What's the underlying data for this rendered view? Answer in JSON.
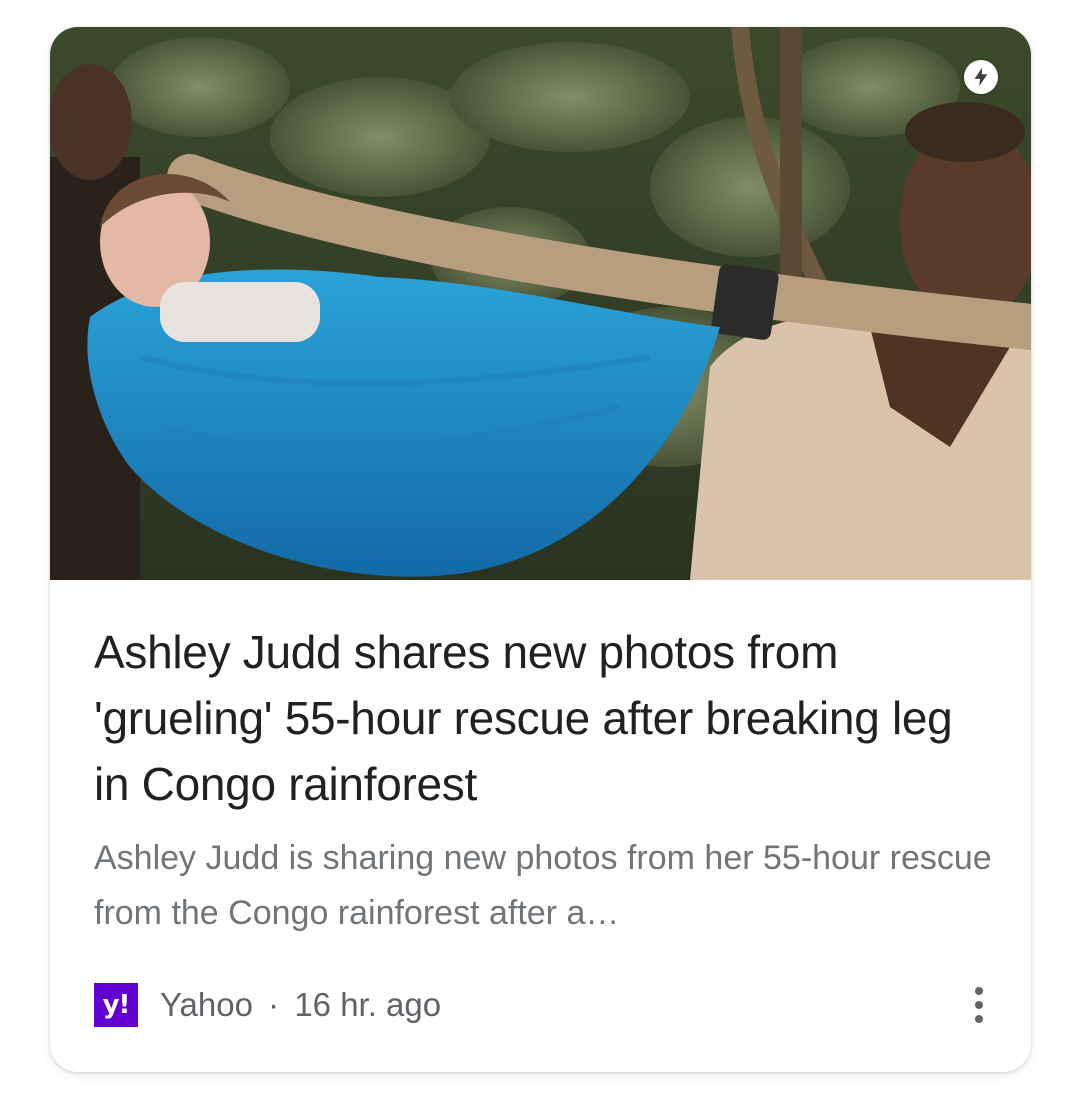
{
  "card": {
    "title": "Ashley Judd shares new photos from 'grueling' 55-hour rescue after breaking leg in Congo rainforest",
    "snippet": "Ashley Judd is sharing new photos from her 55-hour rescue from the Congo rainforest after a…",
    "amp_icon": "lightning-bolt-icon",
    "source": {
      "logo_text": "y!",
      "logo_color": "#6001d2",
      "name": "Yahoo",
      "separator": "·",
      "time": "16 hr. ago"
    },
    "more_icon": "more-vert-icon"
  }
}
